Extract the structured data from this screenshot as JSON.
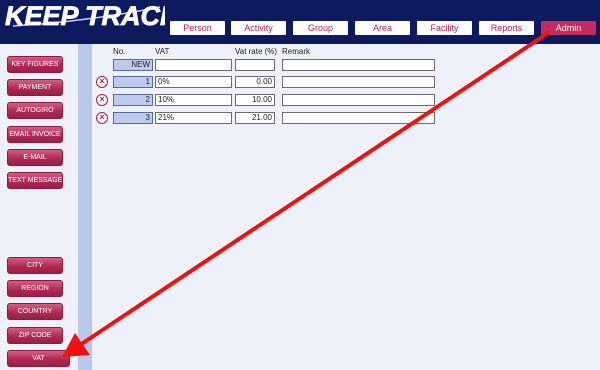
{
  "app": {
    "logo": "KEEP TRACK"
  },
  "nav": {
    "tabs": [
      "Person",
      "Activity",
      "Group",
      "Area",
      "Facility",
      "Reports",
      "Admin"
    ],
    "active": "Admin"
  },
  "sidebar": {
    "top_items": [
      "KEY FIGURES",
      "PAYMENT",
      "AUTOGIRO",
      "EMAIL INVOICE",
      "E-MAIL",
      "TEXT MESSAGE"
    ],
    "bottom_items": [
      "CITY",
      "REGION",
      "COUNTRY",
      "ZIP CODE",
      "VAT"
    ]
  },
  "table": {
    "headers": {
      "no": "No.",
      "vat": "VAT",
      "rate": "Vat rate (%)",
      "remark": "Remark"
    },
    "new_row": {
      "no": "NEW",
      "vat": "",
      "rate": "",
      "remark": ""
    },
    "rows": [
      {
        "no": "1",
        "vat": "0%",
        "rate": "0.00",
        "remark": ""
      },
      {
        "no": "2",
        "vat": "10%",
        "rate": "10.00",
        "remark": ""
      },
      {
        "no": "3",
        "vat": "21%",
        "rate": "21.00",
        "remark": ""
      }
    ]
  },
  "icons": {
    "delete": "delete-icon",
    "arrow": "arrow-annotation"
  },
  "colors": {
    "header": "#0d1a5e",
    "accent": "#c42a5c",
    "arrow": "#ee1111"
  }
}
